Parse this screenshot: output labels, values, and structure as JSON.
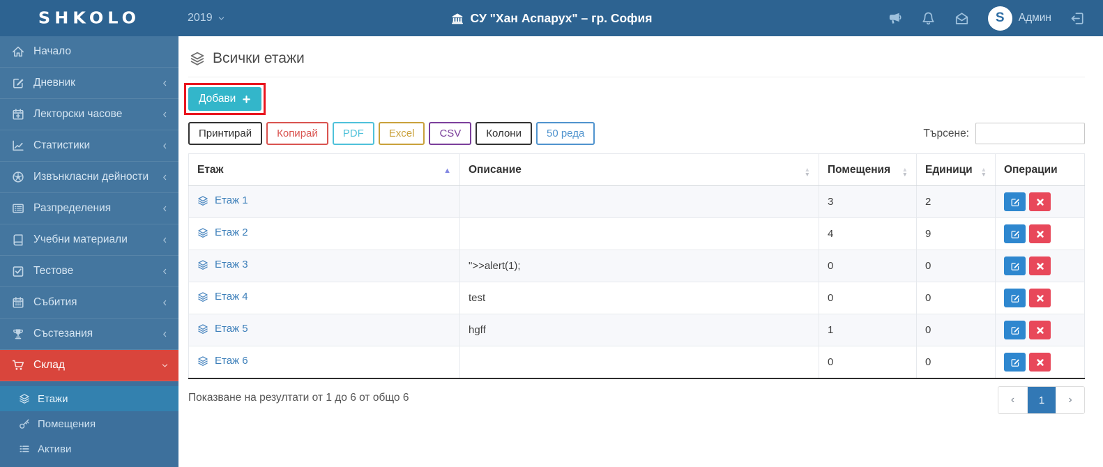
{
  "topbar": {
    "logo": "SHKOLO",
    "year": "2019",
    "school": "СУ \"Хан Аспарух\" – гр. София",
    "avatar_letter": "S",
    "user": "Админ"
  },
  "sidebar": {
    "items": [
      {
        "key": "home",
        "label": "Начало",
        "icon": "home",
        "expandable": false,
        "active": false
      },
      {
        "key": "diary",
        "label": "Дневник",
        "icon": "pencil-square",
        "expandable": true,
        "active": false
      },
      {
        "key": "lecture-hours",
        "label": "Лекторски часове",
        "icon": "calendar-plus",
        "expandable": true,
        "active": false
      },
      {
        "key": "statistics",
        "label": "Статистики",
        "icon": "chart-line",
        "expandable": true,
        "active": false
      },
      {
        "key": "extracurricular",
        "label": "Извънкласни дейности",
        "icon": "futbol",
        "expandable": true,
        "active": false
      },
      {
        "key": "distributions",
        "label": "Разпределения",
        "icon": "table-list",
        "expandable": true,
        "active": false
      },
      {
        "key": "study-materials",
        "label": "Учебни материали",
        "icon": "book",
        "expandable": true,
        "active": false
      },
      {
        "key": "tests",
        "label": "Тестове",
        "icon": "check-square",
        "expandable": true,
        "active": false
      },
      {
        "key": "events",
        "label": "Събития",
        "icon": "calendar",
        "expandable": true,
        "active": false
      },
      {
        "key": "competitions",
        "label": "Състезания",
        "icon": "trophy",
        "expandable": true,
        "active": false
      },
      {
        "key": "warehouse",
        "label": "Склад",
        "icon": "cart",
        "expandable": true,
        "active": true,
        "expanded": true
      }
    ],
    "submenu": [
      {
        "key": "floors",
        "label": "Етажи",
        "icon": "layers",
        "active": true
      },
      {
        "key": "rooms",
        "label": "Помещения",
        "icon": "key",
        "active": false
      },
      {
        "key": "assets",
        "label": "Активи",
        "icon": "list-ul",
        "active": false
      }
    ]
  },
  "page": {
    "title": "Всички етажи",
    "add_label": "Добави",
    "toolbar": [
      {
        "key": "print",
        "label": "Принтирай",
        "color": "#323232"
      },
      {
        "key": "copy",
        "label": "Копирай",
        "color": "#d9534f"
      },
      {
        "key": "pdf",
        "label": "PDF",
        "color": "#4ec1da"
      },
      {
        "key": "excel",
        "label": "Excel",
        "color": "#c9a13b"
      },
      {
        "key": "csv",
        "label": "CSV",
        "color": "#7b3f9b"
      },
      {
        "key": "columns",
        "label": "Колони",
        "color": "#323232"
      },
      {
        "key": "rows-50",
        "label": "50 реда",
        "color": "#4f93ce"
      }
    ],
    "search_label": "Търсене:",
    "search_value": ""
  },
  "table": {
    "columns": [
      {
        "key": "floor",
        "label": "Етаж",
        "sort": "asc"
      },
      {
        "key": "description",
        "label": "Описание",
        "sort": "none"
      },
      {
        "key": "rooms",
        "label": "Помещения",
        "sort": "none"
      },
      {
        "key": "units",
        "label": "Единици",
        "sort": "none"
      },
      {
        "key": "operations",
        "label": "Операции",
        "sort": null
      }
    ],
    "rows": [
      {
        "floor": "Етаж 1",
        "description": "",
        "rooms": "3",
        "units": "2"
      },
      {
        "floor": "Етаж 2",
        "description": "",
        "rooms": "4",
        "units": "9"
      },
      {
        "floor": "Етаж 3",
        "description": "\">>alert(1);",
        "rooms": "0",
        "units": "0"
      },
      {
        "floor": "Етаж 4",
        "description": "test",
        "rooms": "0",
        "units": "0"
      },
      {
        "floor": "Етаж 5",
        "description": "hgff",
        "rooms": "1",
        "units": "0"
      },
      {
        "floor": "Етаж 6",
        "description": "",
        "rooms": "0",
        "units": "0"
      }
    ],
    "footer_text": "Показване на резултати от 1 до 6 от общо 6",
    "pagination": {
      "prev": "‹",
      "current": "1",
      "next": "›"
    }
  },
  "colors": {
    "topbar_bg": "#2d6391",
    "sidebar_bg": "#44769f",
    "submenu_bg": "#3d709c",
    "active_item_red": "#d9453c",
    "active_subitem_blue": "#3381af",
    "add_button_teal": "#33b6ca",
    "annotation_red": "#e9161f",
    "link_blue": "#3b7eb9",
    "edit_button_blue": "#2e87cf",
    "delete_button_red": "#e8485a",
    "pagination_active_blue": "#3278b5",
    "sort_asc_purple": "#8287e2"
  }
}
